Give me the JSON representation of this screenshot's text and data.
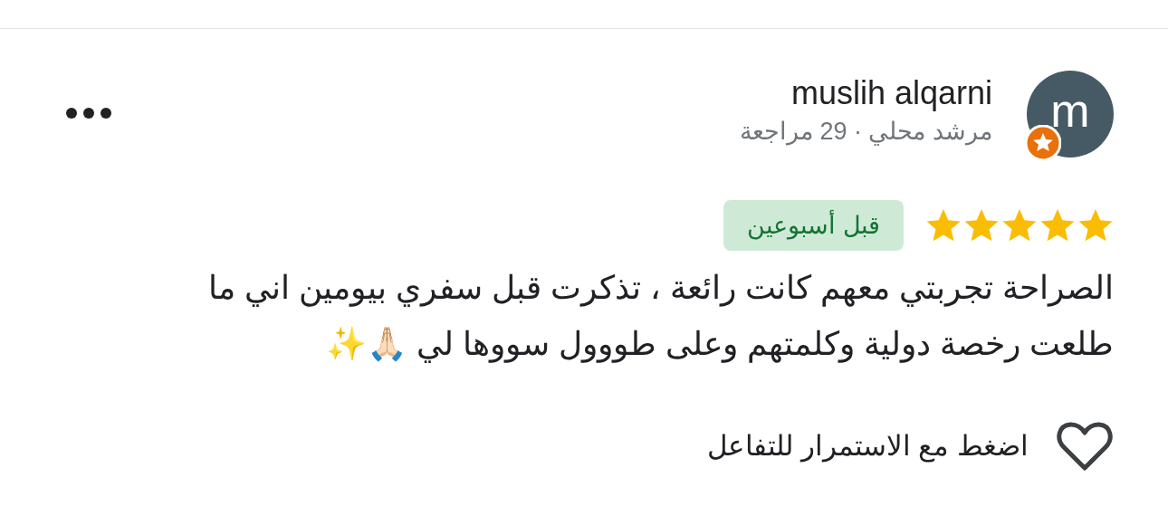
{
  "review": {
    "author": {
      "avatar_letter": "m",
      "name": "muslih alqarni",
      "subtitle": "مرشد محلي · 29 مراجعة",
      "local_guide": true
    },
    "stars": 5,
    "date": "قبل أسبوعين",
    "text": "الصراحة تجربتي معهم كانت رائعة ، تذكرت قبل سفري بيومين اني ما طلعت رخصة دولية وكلمتهم وعلى طووول سووها لي 🙏🏻✨",
    "reaction": {
      "label": "اضغط مع الاستمرار للتفاعل",
      "liked": false
    }
  }
}
